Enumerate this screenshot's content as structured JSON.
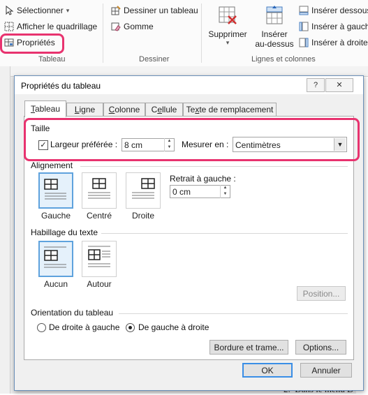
{
  "ribbon": {
    "select_label": "Sélectionner",
    "select_arrow": "▾",
    "gridlines_label": "Afficher le quadrillage",
    "properties_label": "Propriétés",
    "group_table": "Tableau",
    "draw_table_label": "Dessiner un tableau",
    "eraser_label": "Gomme",
    "group_draw": "Dessiner",
    "delete_label": "Supprimer",
    "delete_arrow": "▾",
    "insert_above_line1": "Insérer",
    "insert_above_line2": "au-dessus",
    "insert_below_label": "Insérer dessous",
    "insert_left_label": "Insérer à gauche",
    "insert_right_label": "Insérer à droite",
    "group_rows_cols": "Lignes et colonnes"
  },
  "dialog": {
    "title": "Propriétés du tableau",
    "help": "?",
    "close": "✕",
    "tabs": [
      {
        "label": "Tableau",
        "underline": "T",
        "rest": "ableau"
      },
      {
        "label": "Ligne",
        "underline": "L",
        "rest": "igne"
      },
      {
        "label": "Colonne",
        "underline": "C",
        "rest": "olonne"
      },
      {
        "label": "Cellule",
        "underline": "e",
        "pre": "C",
        "rest": "llule"
      },
      {
        "label": "Texte de remplacement",
        "underline": "x",
        "pre": "Te",
        "rest": "te de remplacement"
      }
    ],
    "size": {
      "heading": "Taille",
      "preferred_width_label": "Largeur préférée :",
      "preferred_width_checked": "✓",
      "width_value": "8 cm",
      "measure_label": "Mesurer en :",
      "measure_value": "Centimètres",
      "dropdown_arrow": "▼"
    },
    "alignment": {
      "heading": "Alignement",
      "options": [
        "Gauche",
        "Centré",
        "Droite"
      ],
      "indent_label": "Retrait à gauche :",
      "indent_value": "0 cm"
    },
    "wrapping": {
      "heading": "Habillage du texte",
      "options": [
        "Aucun",
        "Autour"
      ],
      "position_button": "Position..."
    },
    "orientation": {
      "heading": "Orientation du tableau",
      "rtl_label": "De droite à gauche",
      "ltr_label": "De gauche à droite"
    },
    "borders_button": "Bordure et trame...",
    "options_button": "Options...",
    "ok_button": "OK",
    "cancel_button": "Annuler"
  },
  "background_doc": {
    "list_number": "2.",
    "list_text": "Dans le menu D"
  },
  "colors": {
    "highlight": "#e8336f",
    "selection_blue": "#5ea2dd",
    "ok_border": "#3a8ee6"
  }
}
